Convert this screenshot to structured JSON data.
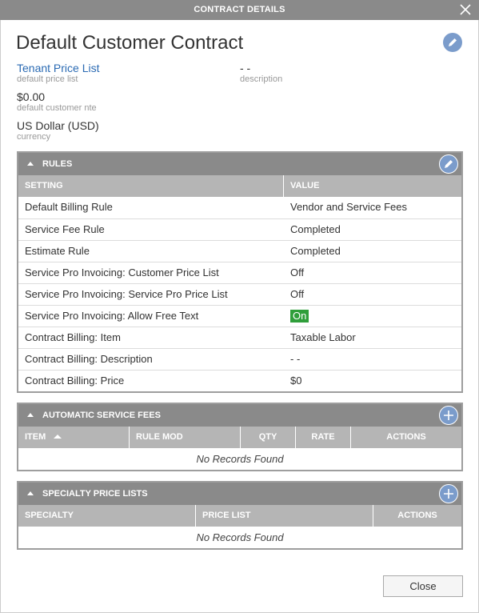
{
  "window": {
    "title": "CONTRACT DETAILS"
  },
  "contract": {
    "title": "Default Customer Contract",
    "price_list": {
      "value": "Tenant Price List",
      "label": "default price list"
    },
    "description": {
      "value": "- -",
      "label": "description"
    },
    "nte": {
      "value": "$0.00",
      "label": "default customer nte"
    },
    "currency": {
      "value": "US Dollar (USD)",
      "label": "currency"
    }
  },
  "rules": {
    "header": "RULES",
    "columns": [
      "SETTING",
      "VALUE"
    ],
    "rows": [
      {
        "setting": "Default Billing Rule",
        "value": "Vendor and Service Fees"
      },
      {
        "setting": "Service Fee Rule",
        "value": "Completed"
      },
      {
        "setting": "Estimate Rule",
        "value": "Completed"
      },
      {
        "setting": "Service Pro Invoicing: Customer Price List",
        "value": "Off"
      },
      {
        "setting": "Service Pro Invoicing: Service Pro Price List",
        "value": "Off"
      },
      {
        "setting": "Service Pro Invoicing: Allow Free Text",
        "value": "On"
      },
      {
        "setting": "Contract Billing: Item",
        "value": "Taxable Labor"
      },
      {
        "setting": "Contract Billing: Description",
        "value": "- -"
      },
      {
        "setting": "Contract Billing: Price",
        "value": "$0"
      }
    ]
  },
  "service_fees": {
    "header": "AUTOMATIC SERVICE FEES",
    "columns": [
      "ITEM",
      "RULE MOD",
      "QTY",
      "RATE",
      "ACTIONS"
    ],
    "empty": "No Records Found"
  },
  "specialty": {
    "header": "SPECIALTY PRICE LISTS",
    "columns": [
      "SPECIALTY",
      "PRICE LIST",
      "ACTIONS"
    ],
    "empty": "No Records Found"
  },
  "footer": {
    "close_label": "Close"
  },
  "colors": {
    "header_gray": "#8a8a8a",
    "column_gray": "#b5b5b5",
    "accent_blue": "#7b9ccb",
    "link_blue": "#2a6ab3",
    "on_green": "#2f9e3a"
  }
}
